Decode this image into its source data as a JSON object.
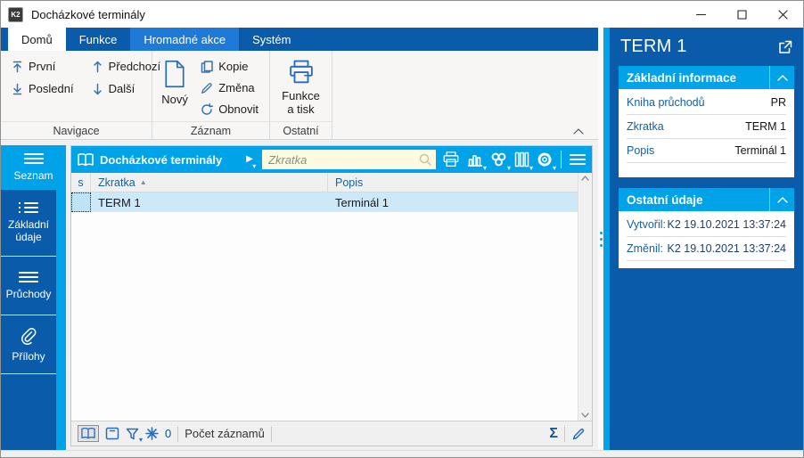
{
  "window": {
    "logo": "K2",
    "title": "Docházkové terminály"
  },
  "tabs": [
    {
      "label": "Domů"
    },
    {
      "label": "Funkce"
    },
    {
      "label": "Hromadné akce"
    },
    {
      "label": "Systém"
    }
  ],
  "ribbon": {
    "nav": {
      "first": "První",
      "last": "Poslední",
      "prev": "Předchozí",
      "next": "Další",
      "group": "Navigace"
    },
    "record": {
      "new": "Nový",
      "copy": "Kopie",
      "change": "Změna",
      "refresh": "Obnovit",
      "group": "Záznam"
    },
    "other": {
      "print": "Funkce a tisk",
      "group": "Ostatní"
    }
  },
  "sidebar": {
    "items": [
      {
        "label": "Seznam"
      },
      {
        "label": "Základní údaje"
      },
      {
        "label": "Průchody"
      },
      {
        "label": "Přílohy"
      }
    ]
  },
  "browse": {
    "title": "Docházkové terminály",
    "search_placeholder": "Zkratka",
    "columns": [
      "s",
      "Zkratka",
      "Popis"
    ],
    "rows": [
      {
        "zkratka": "TERM 1",
        "popis": "Terminál 1"
      }
    ],
    "status": {
      "frozen_count": "0",
      "count_label": "Počet záznamů"
    }
  },
  "detail": {
    "title": "TERM 1",
    "sections": [
      {
        "title": "Základní informace",
        "rows": [
          {
            "label": "Kniha průchodů",
            "value": "PR"
          },
          {
            "label": "Zkratka",
            "value": "TERM 1"
          },
          {
            "label": "Popis",
            "value": "Terminál 1"
          }
        ]
      },
      {
        "title": "Ostatní údaje",
        "rows": [
          {
            "label": "Vytvořil:",
            "value": "K2 19.10.2021 13:37:24"
          },
          {
            "label": "Změnil:",
            "value": "K2 19.10.2021 13:37:24"
          }
        ]
      }
    ]
  },
  "icons_text": {
    "play": "▶",
    "caret": "▾",
    "sum": "Σ",
    "sort_asc": "▲"
  },
  "colors": {
    "dark_blue": "#0a5cab",
    "cyan": "#00a2e8",
    "tab_highlight": "#1e7ad6",
    "selected_row": "#cde9f8",
    "search_bg": "#fcfbe2",
    "icon_blue": "#2a6db8",
    "label_blue": "#15609f"
  }
}
